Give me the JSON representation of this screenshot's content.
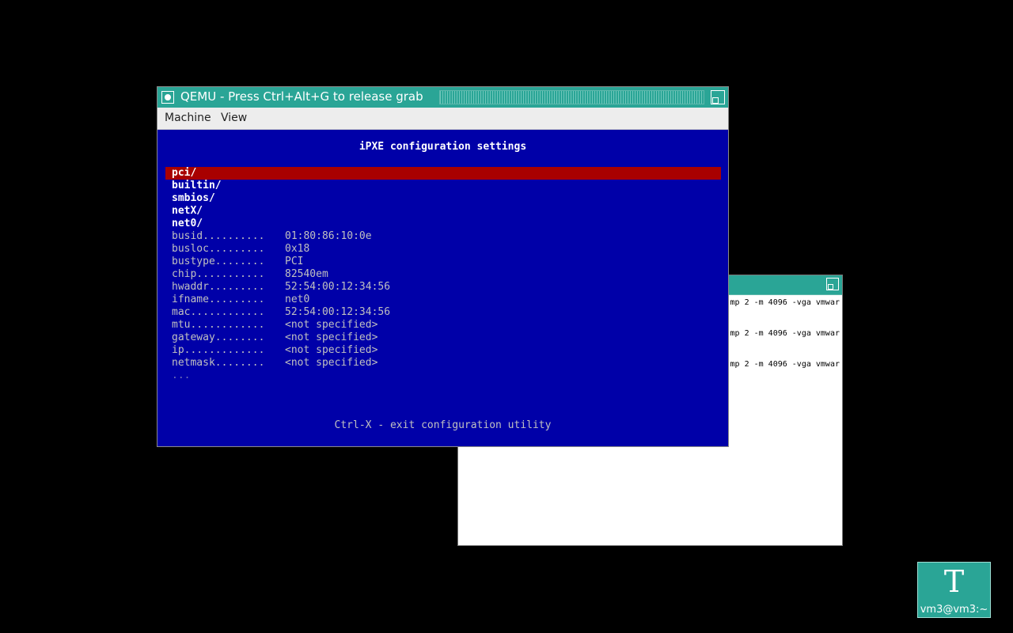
{
  "terminal_window": {
    "lines": [
      "mp 2 -m 4096 -vga vmwar",
      "mp 2 -m 4096 -vga vmwar",
      "mp 2 -m 4096 -vga vmwar"
    ]
  },
  "qemu": {
    "title": "QEMU - Press Ctrl+Alt+G to release grab",
    "menu": [
      "Machine",
      "View"
    ]
  },
  "ipxe": {
    "heading": "iPXE configuration settings",
    "directories": [
      "pci/",
      "builtin/",
      "smbios/",
      "netX/",
      "net0/"
    ],
    "selected_index": 0,
    "settings": [
      {
        "label": "busid..........",
        "value": "01:80:86:10:0e"
      },
      {
        "label": "busloc.........",
        "value": "0x18"
      },
      {
        "label": "bustype........",
        "value": "PCI"
      },
      {
        "label": "chip...........",
        "value": "82540em"
      },
      {
        "label": "hwaddr.........",
        "value": "52:54:00:12:34:56"
      },
      {
        "label": "ifname.........",
        "value": "net0"
      },
      {
        "label": "mac............",
        "value": "52:54:00:12:34:56"
      },
      {
        "label": "mtu............",
        "value": "<not specified>"
      },
      {
        "label": "gateway........",
        "value": "<not specified>"
      },
      {
        "label": "ip.............",
        "value": "<not specified>"
      },
      {
        "label": "netmask........",
        "value": "<not specified>"
      }
    ],
    "more_indicator": "...",
    "footer": "Ctrl-X - exit configuration utility"
  },
  "desktop_icon": {
    "glyph": "T",
    "label": "vm3@vm3:~"
  },
  "colors": {
    "desktop": "#000000",
    "titlebar": "#2aa596",
    "ipxe_background": "#0000a8",
    "ipxe_highlight": "#a80000"
  }
}
